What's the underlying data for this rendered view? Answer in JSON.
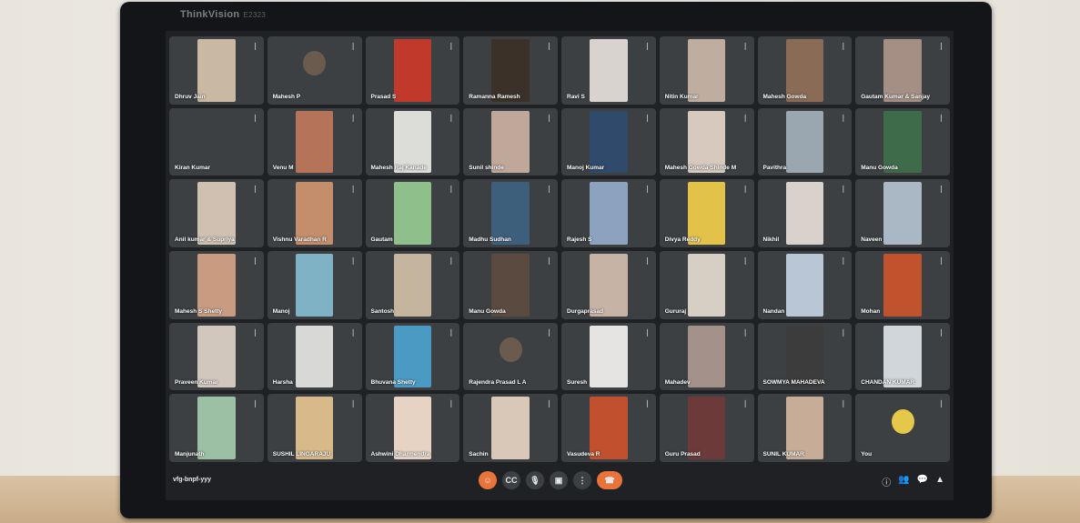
{
  "monitor": {
    "brand": "ThinkVision",
    "model": "E2323"
  },
  "meeting": {
    "code": "vfg-bnpf-yyy",
    "participants": [
      {
        "name": "Dhruv Jain",
        "video": "#c9b9a3"
      },
      {
        "name": "Mahesh P",
        "video": "avatar"
      },
      {
        "name": "Prasad S",
        "video": "#c0392b"
      },
      {
        "name": "Ramanna Ramesh",
        "video": "#3b3128"
      },
      {
        "name": "Ravi S",
        "video": "#d9d3cf"
      },
      {
        "name": "Nitin Kumar",
        "video": "#bfae9f"
      },
      {
        "name": "Mahesh Gowda",
        "video": "#8a6b55"
      },
      {
        "name": "Gautam Kumar & Sanjay",
        "video": "#a58f85"
      },
      {
        "name": "Kiran Kumar",
        "video": "none"
      },
      {
        "name": "Venu M",
        "video": "#b5735a"
      },
      {
        "name": "Mahesh Raj Kanade",
        "video": "#dcdcd8"
      },
      {
        "name": "Sunil shinde",
        "video": "#bfa79a"
      },
      {
        "name": "Manoj Kumar",
        "video": "#2f4a6a"
      },
      {
        "name": "Mahesh Gowda Shinde M",
        "video": "#d7c9bd"
      },
      {
        "name": "Pavithra",
        "video": "#9aa7b1"
      },
      {
        "name": "Manu Gowda",
        "video": "#3e6b4a"
      },
      {
        "name": "Anil kumar & Supriya",
        "video": "#cfc0b1"
      },
      {
        "name": "Vishnu Varadhan R",
        "video": "#c48d6b"
      },
      {
        "name": "Gautam",
        "video": "#8fbf8a"
      },
      {
        "name": "Madhu Sudhan",
        "video": "#3e5f7c"
      },
      {
        "name": "Rajesh S",
        "video": "#8ba3bf"
      },
      {
        "name": "Divya Reddy",
        "video": "#e3c24a"
      },
      {
        "name": "Nikhil",
        "video": "#d9d1cc"
      },
      {
        "name": "Naveen",
        "video": "#aab7c4"
      },
      {
        "name": "Mahesh S Shetty",
        "video": "#c99c82"
      },
      {
        "name": "Manoj",
        "video": "#7fb2c4"
      },
      {
        "name": "Santosh",
        "video": "#c6b59e"
      },
      {
        "name": "Manu Gowda",
        "video": "#5b4a40"
      },
      {
        "name": "Durgaprasad",
        "video": "#c7b2a6"
      },
      {
        "name": "Gururaj",
        "video": "#d6cfc4"
      },
      {
        "name": "Nandan",
        "video": "#b8c6d6"
      },
      {
        "name": "Mohan",
        "video": "#c0522e"
      },
      {
        "name": "Praveen Kumar",
        "video": "#d2c7bd"
      },
      {
        "name": "Harsha",
        "video": "#d8d8d6"
      },
      {
        "name": "Bhuvana Shetty",
        "video": "#4a9ac4"
      },
      {
        "name": "Rajendra Prasad L A",
        "video": "avatar"
      },
      {
        "name": "Suresh",
        "video": "#e6e4e2"
      },
      {
        "name": "Mahadev",
        "video": "#a4928a"
      },
      {
        "name": "SOWMYA MAHADEVA",
        "video": "#3c3c3c"
      },
      {
        "name": "CHANDAN KUMAR",
        "video": "#d0d6da"
      },
      {
        "name": "Manjunath",
        "video": "#9cc0a4"
      },
      {
        "name": "SUSHIL LINGARAJU",
        "video": "#d8b98a"
      },
      {
        "name": "Ashwini Dharmendra",
        "video": "#e7d3c3"
      },
      {
        "name": "Sachin",
        "video": "#d9c8b8"
      },
      {
        "name": "Vasudeva R",
        "video": "#c0502e"
      },
      {
        "name": "Guru Prasad",
        "video": "#6d3a3a"
      },
      {
        "name": "SUNIL KUMAR",
        "video": "#c7ad98"
      },
      {
        "name": "You",
        "video": "emoji"
      }
    ]
  },
  "controls": [
    {
      "name": "reactions-button",
      "glyph": "☺",
      "style": "orange"
    },
    {
      "name": "captions-button",
      "glyph": "CC",
      "style": "dark"
    },
    {
      "name": "mic-button",
      "glyph": "🎙",
      "style": "dark"
    },
    {
      "name": "camera-button",
      "glyph": "▣",
      "style": "dark"
    },
    {
      "name": "more-options-button",
      "glyph": "⋮",
      "style": "dark"
    },
    {
      "name": "end-call-button",
      "glyph": "☎",
      "style": "end"
    }
  ],
  "right_icons": [
    {
      "name": "info-icon",
      "glyph": "ⓘ"
    },
    {
      "name": "people-icon",
      "glyph": "👥"
    },
    {
      "name": "chat-icon",
      "glyph": "💬"
    },
    {
      "name": "activities-icon",
      "glyph": "▲"
    }
  ]
}
